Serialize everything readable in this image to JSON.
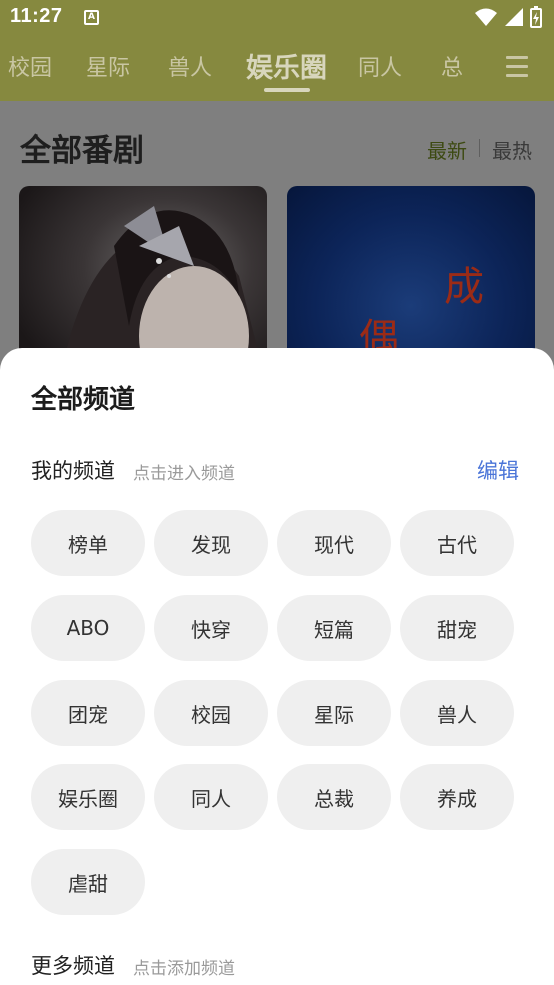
{
  "status_bar": {
    "time": "11:27",
    "notification_glyph": "A"
  },
  "nav": {
    "tabs": [
      "校园",
      "星际",
      "兽人",
      "娱乐圈",
      "同人",
      "总"
    ],
    "active_index": 3
  },
  "section": {
    "title": "全部番剧",
    "sort_new": "最新",
    "sort_hot": "最热"
  },
  "cards": {
    "card2_glyph_top": "成",
    "card2_glyph_left": "偶"
  },
  "sheet": {
    "title": "全部频道",
    "my_channels_label": "我的频道",
    "my_channels_hint": "点击进入频道",
    "edit_label": "编辑",
    "channels": [
      "榜单",
      "发现",
      "现代",
      "古代",
      "ABO",
      "快穿",
      "短篇",
      "甜宠",
      "团宠",
      "校园",
      "星际",
      "兽人",
      "娱乐圈",
      "同人",
      "总裁",
      "养成",
      "虐甜"
    ],
    "more_channels_label": "更多频道",
    "more_channels_hint": "点击添加频道"
  },
  "colors": {
    "accent_edit": "#4a74d8",
    "sort_active": "#3d4a12",
    "nav_bg": "#86893f"
  }
}
